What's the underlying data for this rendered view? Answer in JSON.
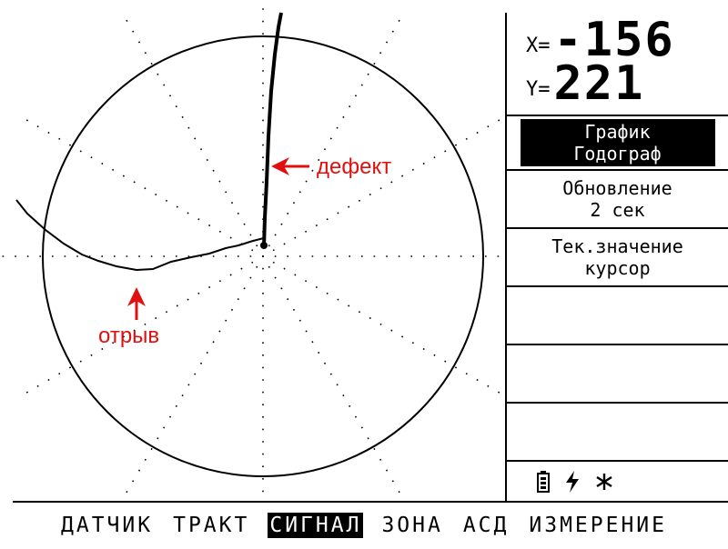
{
  "readout": {
    "x_label": "X=",
    "x_value": "-156",
    "y_label": "Y=",
    "y_value": "221"
  },
  "menu": {
    "graph_line1": "График",
    "graph_line2": "Годограф",
    "update_line1": "Обновление",
    "update_line2": "2 сек",
    "current_line1": "Тек.значение",
    "current_line2": "курсор"
  },
  "status": {
    "battery_icon": "battery-icon",
    "power_icon": "lightning-icon",
    "light_icon": "asterisk-icon"
  },
  "tabs": [
    {
      "label": "ДАТЧИК",
      "active": false
    },
    {
      "label": "ТРАКТ",
      "active": false
    },
    {
      "label": "СИГНАЛ",
      "active": true
    },
    {
      "label": "ЗОНА",
      "active": false
    },
    {
      "label": "АСД",
      "active": false
    },
    {
      "label": "ИЗМЕРЕНИЕ",
      "active": false
    }
  ],
  "annotations": {
    "defect": "дефект",
    "break": "отрыв"
  },
  "colors": {
    "annotation": "#e01010",
    "foreground": "#000000",
    "background": "#ffffff"
  }
}
